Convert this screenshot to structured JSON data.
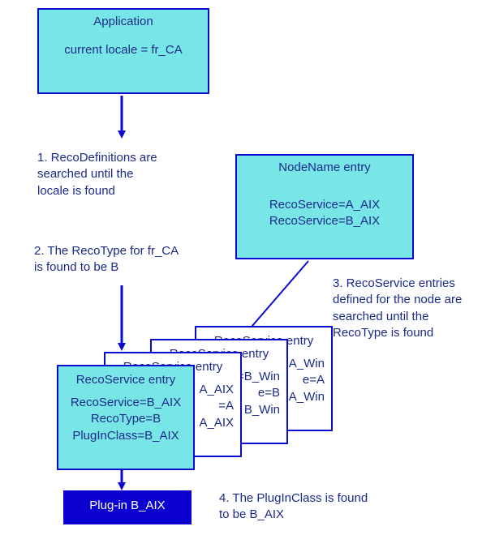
{
  "application": {
    "title": "Application",
    "locale_line": "current locale =  fr_CA"
  },
  "node_entry": {
    "title": "NodeName entry",
    "line1": "RecoService=A_AIX",
    "line2": "RecoService=B_AIX"
  },
  "notes": {
    "n1": "1. RecoDefinitions are searched until the locale is found",
    "n2": "2. The RecoType for fr_CA is found to be B",
    "n3": "3. RecoService entries defined for the node are searched until the RecoType is found",
    "n4": "4. The PlugInClass is found to be B_AIX"
  },
  "cards": {
    "back": {
      "title": "RecoService entry",
      "l1": "e=A_Win",
      "l2": "e=A",
      "l3": "=A_Win"
    },
    "p3": {
      "title": "RecoService entry",
      "l1": "=B_Win",
      "l2": "e=B",
      "l3": "B_Win"
    },
    "p2": {
      "title": "RecoService entry",
      "l1": "A_AIX",
      "l2": "=A",
      "l3": "A_AIX"
    },
    "front": {
      "title": "RecoService entry",
      "l1": "RecoService=B_AIX",
      "l2": "RecoType=B",
      "l3": "PlugInClass=B_AIX"
    }
  },
  "plugin": {
    "label": "Plug-in B_AIX"
  }
}
